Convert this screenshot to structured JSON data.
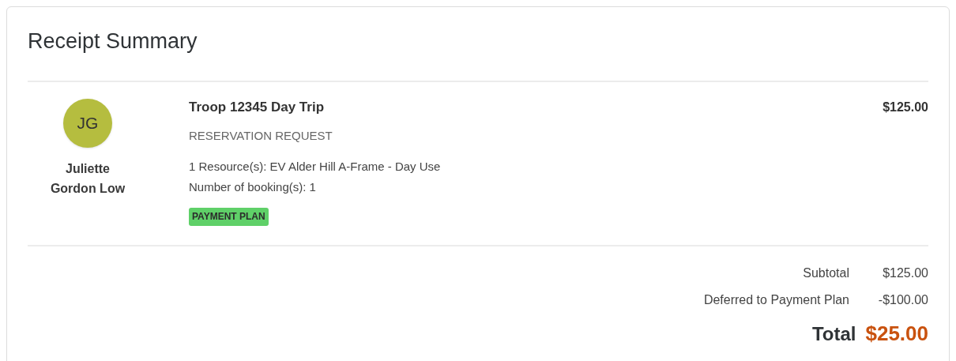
{
  "title": "Receipt Summary",
  "item": {
    "avatar_initials": "JG",
    "person": "Juliette Gordon Low",
    "name": "Troop 12345 Day Trip",
    "type": "RESERVATION REQUEST",
    "details": [
      "1 Resource(s): EV Alder Hill A-Frame - Day Use",
      "Number of booking(s): 1"
    ],
    "badge": "PAYMENT PLAN",
    "price": "$125.00"
  },
  "summary": [
    {
      "label": "Subtotal",
      "value": "$125.00"
    },
    {
      "label": "Deferred to Payment Plan",
      "value": "-$100.00"
    }
  ],
  "total": {
    "label": "Total",
    "value": "$25.00"
  }
}
